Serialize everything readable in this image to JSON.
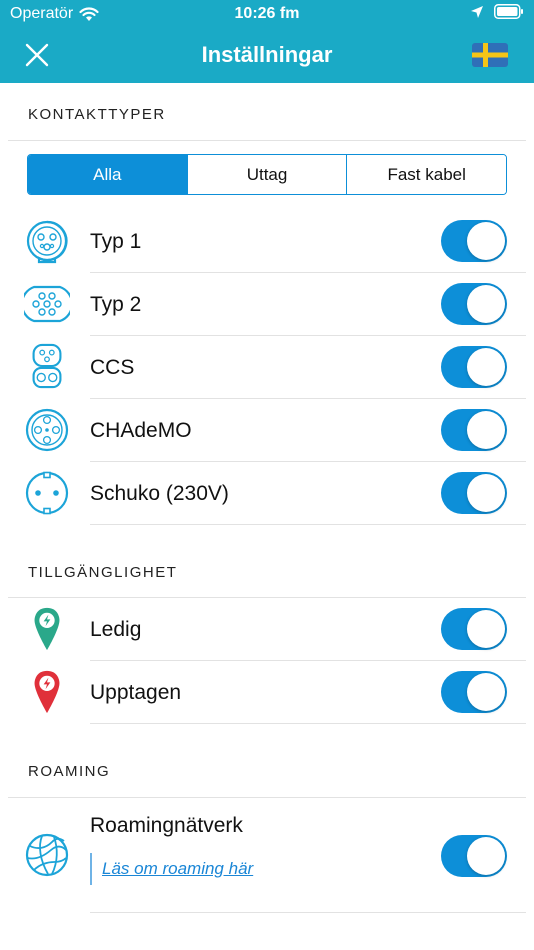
{
  "status_bar": {
    "carrier": "Operatör",
    "time": "10:26 fm"
  },
  "nav": {
    "title": "Inställningar",
    "close_icon": "close-icon",
    "flag_icon": "sweden-flag-icon"
  },
  "connector_types": {
    "header": "KONTAKTTYPER",
    "segments": [
      {
        "label": "Alla",
        "active": true
      },
      {
        "label": "Uttag",
        "active": false
      },
      {
        "label": "Fast kabel",
        "active": false
      }
    ],
    "items": [
      {
        "label": "Typ 1",
        "icon": "type1-connector-icon",
        "enabled": true
      },
      {
        "label": "Typ 2",
        "icon": "type2-connector-icon",
        "enabled": true
      },
      {
        "label": "CCS",
        "icon": "ccs-connector-icon",
        "enabled": true
      },
      {
        "label": "CHAdeMO",
        "icon": "chademo-connector-icon",
        "enabled": true
      },
      {
        "label": "Schuko (230V)",
        "icon": "schuko-connector-icon",
        "enabled": true
      }
    ]
  },
  "availability": {
    "header": "TILLGÄNGLIGHET",
    "items": [
      {
        "label": "Ledig",
        "icon": "available-pin-icon",
        "enabled": true
      },
      {
        "label": "Upptagen",
        "icon": "occupied-pin-icon",
        "enabled": true
      }
    ]
  },
  "roaming": {
    "header": "ROAMING",
    "label": "Roamingnätverk",
    "link": "Läs om roaming här",
    "icon": "globe-icon",
    "enabled": true
  },
  "colors": {
    "header_bg": "#1aaac6",
    "accent": "#0d8fd8",
    "available": "#2aa88a",
    "occupied": "#e0303a"
  }
}
